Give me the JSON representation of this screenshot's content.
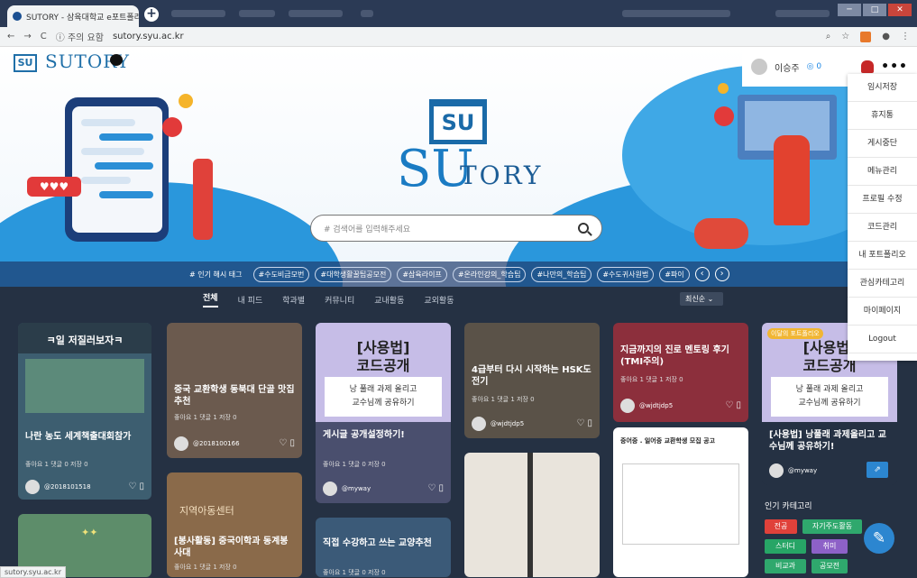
{
  "browser": {
    "tab_title": "SUTORY - 삼육대학교 e포트폴리",
    "tab_close": "×",
    "new_tab": "+",
    "nav_back": "←",
    "nav_forward": "→",
    "nav_reload": "C",
    "security_note": "ⓘ 주의 요함",
    "url": "sutory.syu.ac.kr",
    "status_url": "sutory.syu.ac.kr",
    "menu_dots": "⋮",
    "window_controls": {
      "min": "─",
      "max": "□",
      "close": "✕"
    }
  },
  "header": {
    "logo_box": "SU",
    "logo_text": "SUTORY",
    "username": "이승주",
    "coin": "0",
    "more": "•••"
  },
  "hero": {
    "logo_box": "SU",
    "logo_su": "SU",
    "logo_tory": "TORY",
    "search_placeholder": "# 검색어를 입력해주세요"
  },
  "user_menu": [
    "임시저장",
    "휴지통",
    "게시중단",
    "메뉴관리",
    "프로필 수정",
    "코드관리",
    "내 포트폴리오",
    "관심카테고리",
    "마이페이지",
    "Logout"
  ],
  "hashtags": {
    "label": "# 인기 해시 태그",
    "tags": [
      "#수도비금모번",
      "#대학생활꿀팁공모전",
      "#삼육라이프",
      "#온라인강의_학습팁",
      "#나만의_학습팁",
      "#수도귀사원법",
      "#파이"
    ],
    "prev": "‹",
    "next": "›"
  },
  "nav_tabs": [
    "전체",
    "내 피드",
    "학과별",
    "커뮤니티",
    "교내활동",
    "교외활동"
  ],
  "sort": "최신순 ⌄",
  "cards": [
    {
      "title": "나란 농도 세계책출대회참가",
      "header": "ㅋ일 저질러보자ㅋ",
      "stats": "좋아요 1   댓글 0   저장 0",
      "user": "@2018101518"
    },
    {
      "title": "중국 교환학생 동북대 단골 맛집 추천",
      "stats": "좋아요 1   댓글 1   저장 0",
      "user": "@2018100166"
    },
    {
      "title": "[봉사활동] 중국이학과 동계봉사대",
      "stats": "좋아요 1   댓글 1   저장 0",
      "sign": "지역아동센터"
    },
    {
      "poster_title": "[사용법]\n코드공개",
      "poster_sub": "낭 풀래 과제 올리고\n교수님께 공유하기",
      "title": "게시글 공개설정하기!",
      "stats": "좋아요 1   댓글 0   저장 0",
      "user": "@myway"
    },
    {
      "title": "직접 수강하고 쓰는 교양추천",
      "stats": "좋아요 1   댓글 0   저장 0"
    },
    {
      "title": "4급부터 다시 시작하는 HSK도전기",
      "stats": "좋아요 1   댓글 1   저장 0",
      "user": "@wjdtjdp5"
    },
    {
      "title": "지금까지의 진로 멘토링 후기 (TMI주의)",
      "stats": "좋아요 1   댓글 1   저장 0",
      "user": "@wjdtjdp5"
    },
    {
      "doc_title": "중어중 . 일어중 교환학생 모집 공고"
    },
    {
      "badge": "이달의 포트폴리오",
      "poster_title": "[사용법]\n코드공개",
      "poster_sub": "낭 풀래 과제 올리고\n교수님께 공유하기",
      "title": "[사용법] 낭풀래 과제올리고 교수님께 공유하기!",
      "user": "@myway"
    }
  ],
  "categories": {
    "title": "인기 카테고리",
    "items": [
      {
        "label": "전공",
        "color": "#e0413a"
      },
      {
        "label": "자기주도활동",
        "color": "#2fa86d"
      },
      {
        "label": "스터디",
        "color": "#27a566"
      },
      {
        "label": "취미",
        "color": "#8d61c7"
      },
      {
        "label": "비교과",
        "color": "#2fa86d"
      },
      {
        "label": "공모전",
        "color": "#2fa86d"
      }
    ]
  },
  "fab": "✎",
  "colors": {
    "brand": "#1f6fa8",
    "dark_bg": "#253143",
    "accent": "#1e88e5"
  }
}
